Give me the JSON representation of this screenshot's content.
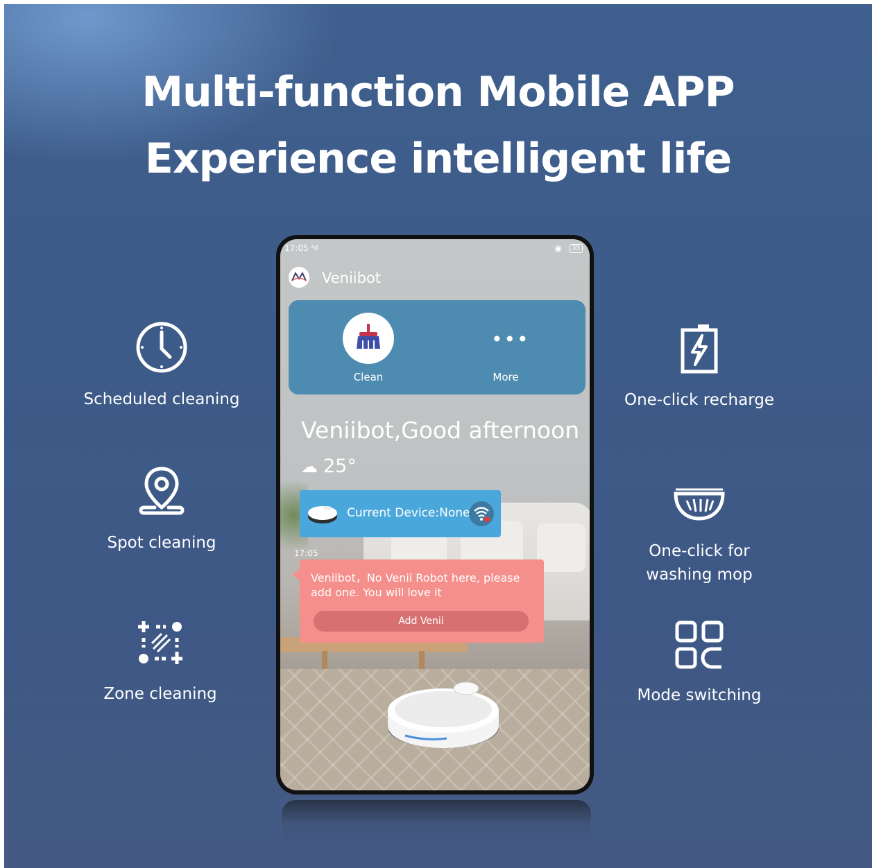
{
  "headline": {
    "line1": "Multi-function Mobile APP",
    "line2": "Experience intelligent life"
  },
  "features": {
    "left": [
      {
        "label": "Scheduled cleaning",
        "icon": "clock-icon"
      },
      {
        "label": "Spot cleaning",
        "icon": "location-pin-icon"
      },
      {
        "label": "Zone cleaning",
        "icon": "zone-select-icon"
      }
    ],
    "right": [
      {
        "label": "One-click recharge",
        "icon": "battery-charge-icon"
      },
      {
        "label": "One-click for\nwashing mop",
        "icon": "mop-icon"
      },
      {
        "label": "Mode switching",
        "icon": "grid-mode-icon"
      }
    ]
  },
  "phone": {
    "status": {
      "time": "17:05",
      "signal": "⁴ıl",
      "battery": "35"
    },
    "app_name": "Veniibot",
    "actions": [
      {
        "label": "Clean",
        "icon": "broom-icon"
      },
      {
        "label": "More",
        "icon": "more-dots-icon"
      }
    ],
    "more_dots": "•••",
    "greeting": "Veniibot,Good afternoon",
    "weather": {
      "icon": "cloud-icon",
      "temperature": "25°"
    },
    "device": {
      "text": "Current Device:None"
    },
    "message": {
      "time": "17:05",
      "text": "Veniibot，No Venii Robot here, please add one. You will love it",
      "button": "Add Venii"
    }
  },
  "colors": {
    "background": "#3e5b88",
    "action_panel": "#4d8cb0",
    "device_card": "#4aa7dc",
    "message_card": "#f48f8c",
    "text": "#ffffff"
  }
}
